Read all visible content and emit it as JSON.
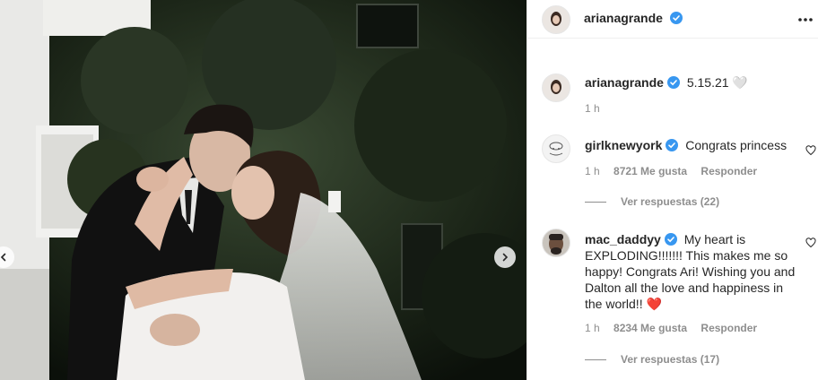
{
  "header": {
    "username": "arianagrande",
    "more_icon": "more-horizontal-icon"
  },
  "caption": {
    "username": "arianagrande",
    "text": "5.15.21 🤍",
    "time": "1 h"
  },
  "comments": [
    {
      "username": "girlknewyork",
      "text": "Congrats princess",
      "time": "1 h",
      "likes": "8721 Me gusta",
      "reply_label": "Responder",
      "view_replies": "Ver respuestas (22)"
    },
    {
      "username": "mac_daddyy",
      "text": "My heart is EXPLODING!!!!!!! This makes me so happy! Congrats Ari! Wishing you and Dalton all the love and happiness in the world!! ❤️",
      "time": "1 h",
      "likes": "8234 Me gusta",
      "reply_label": "Responder",
      "view_replies": "Ver respuestas (17)"
    }
  ],
  "colors": {
    "verified": "#3897f0",
    "text": "#262626",
    "muted": "#8e8e8e",
    "heart_emoji": "#e0245e"
  }
}
